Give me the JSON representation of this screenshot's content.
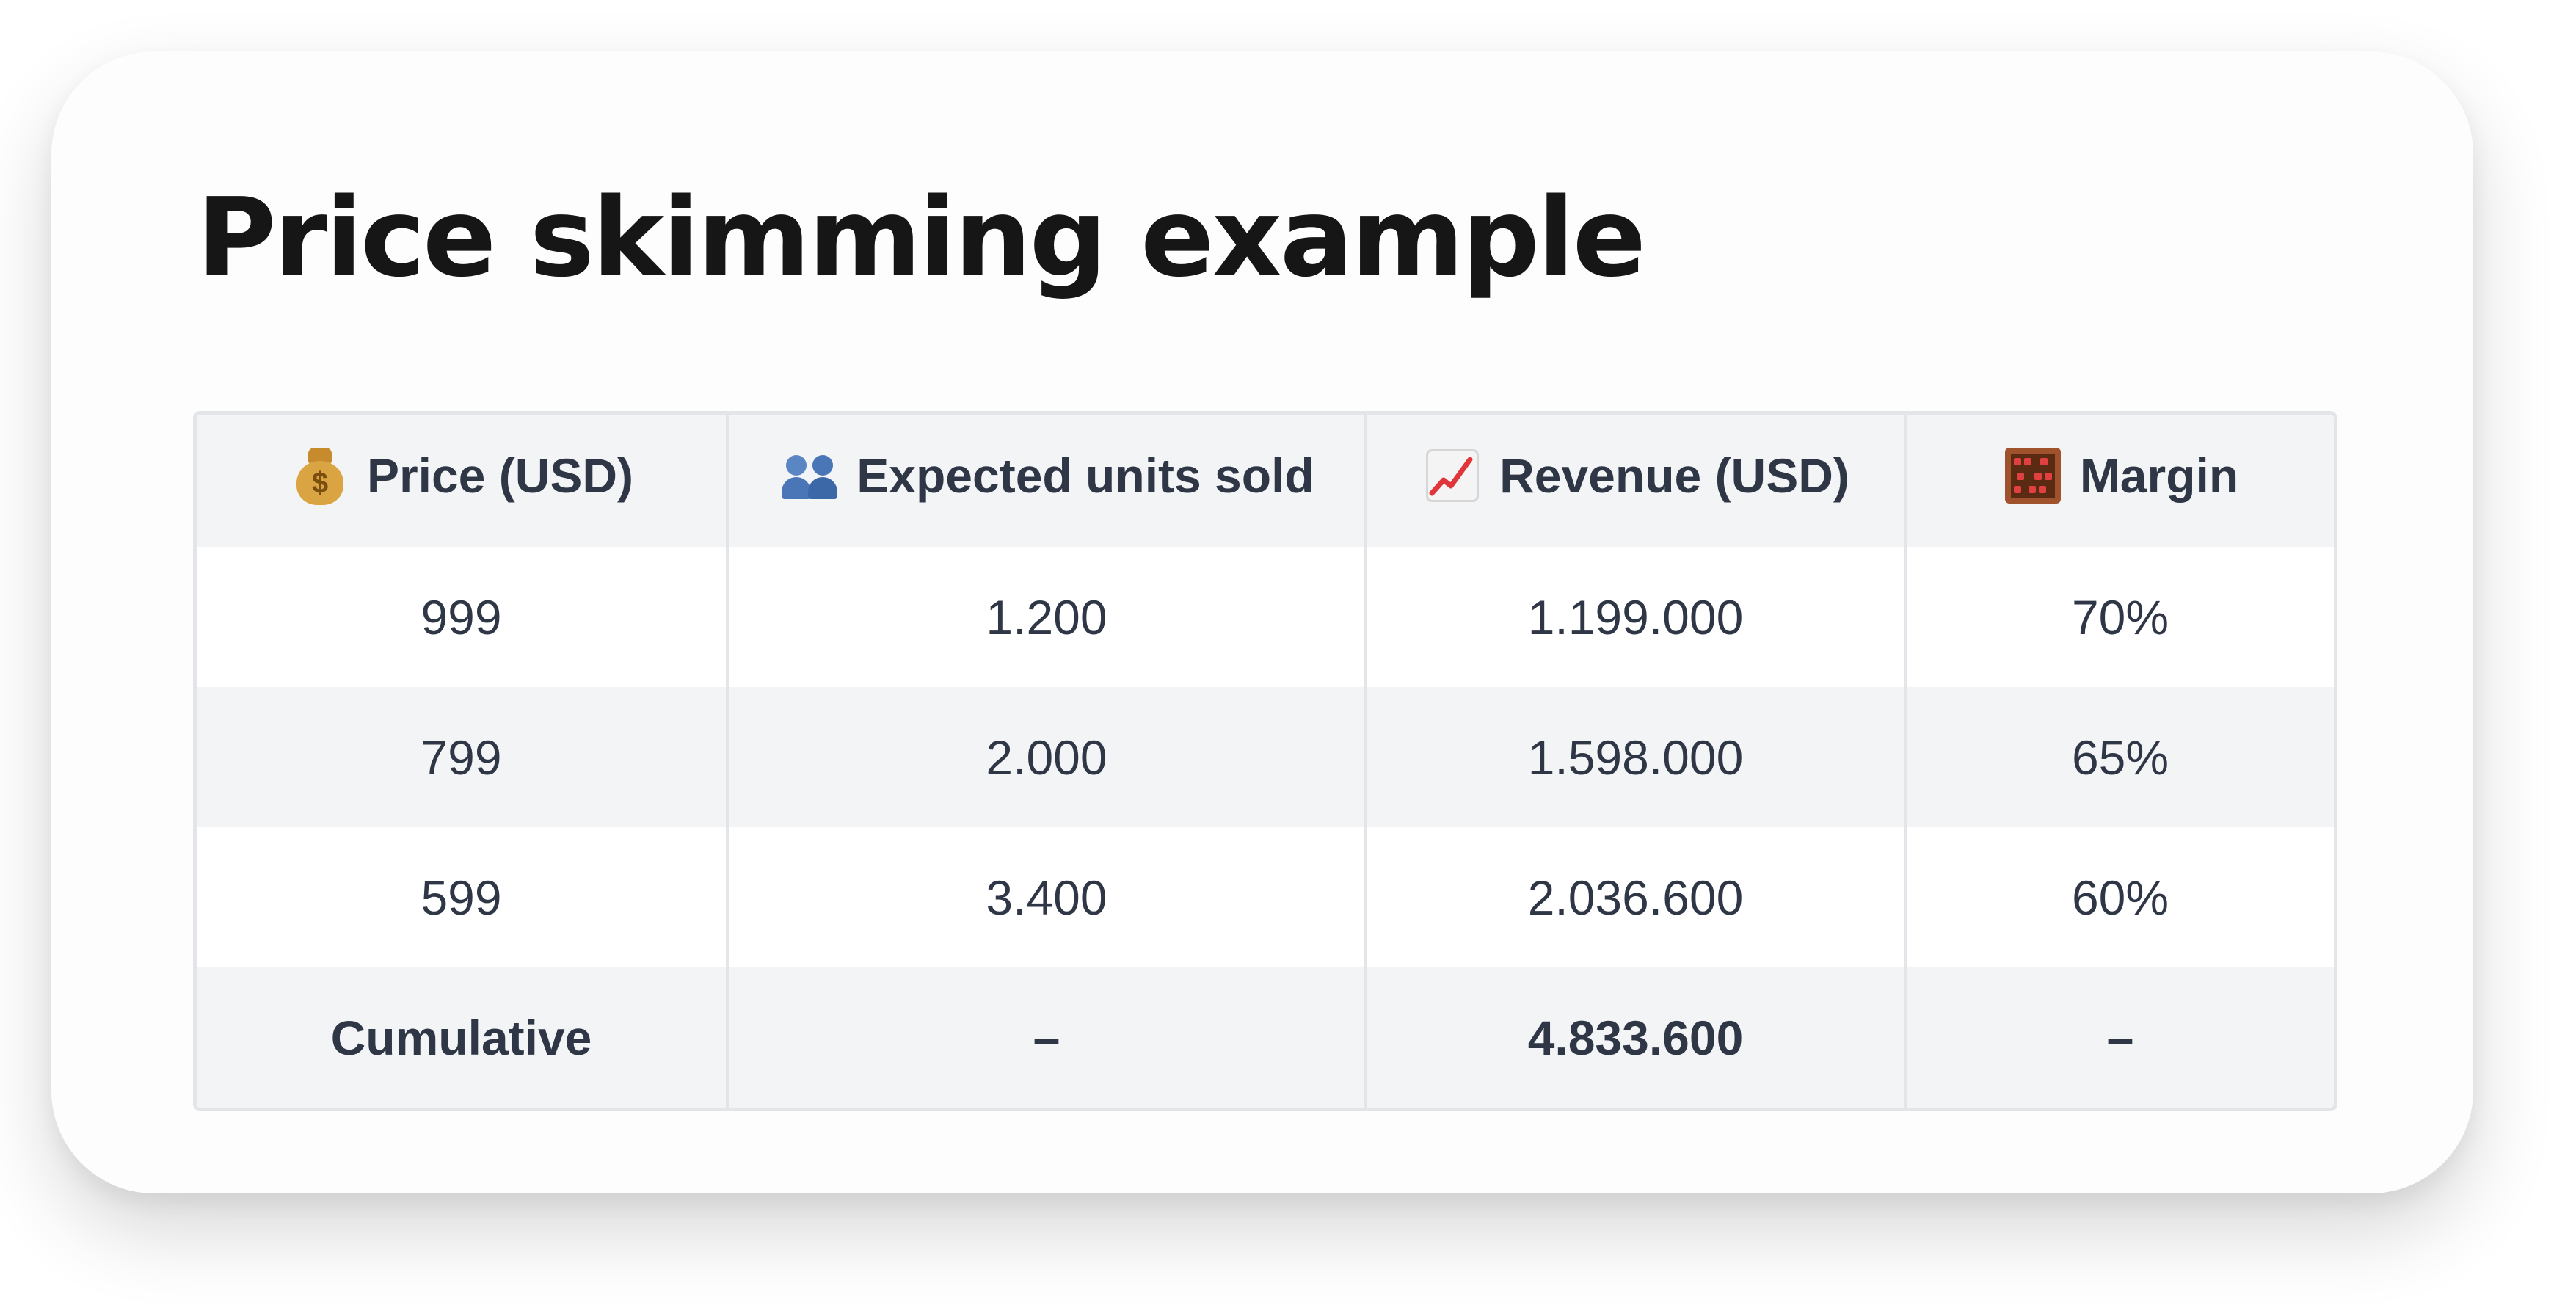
{
  "title": "Price skimming example",
  "table": {
    "headers": [
      {
        "icon": "money-bag-icon",
        "label": "Price (USD)"
      },
      {
        "icon": "people-icon",
        "label": "Expected units sold"
      },
      {
        "icon": "chart-increasing-icon",
        "label": "Revenue (USD)"
      },
      {
        "icon": "abacus-icon",
        "label": "Margin"
      }
    ],
    "rows": [
      {
        "price": "999",
        "units": "1.200",
        "revenue": "1.199.000",
        "margin": "70%"
      },
      {
        "price": "799",
        "units": "2.000",
        "revenue": "1.598.000",
        "margin": "65%"
      },
      {
        "price": "599",
        "units": "3.400",
        "revenue": "2.036.600",
        "margin": "60%"
      }
    ],
    "total": {
      "label": "Cumulative",
      "units": "–",
      "revenue": "4.833.600",
      "margin": "–"
    }
  },
  "colors": {
    "header_bg": "#f3f4f6",
    "border": "#e3e5e8",
    "text": "#2f3747",
    "title": "#161616"
  }
}
